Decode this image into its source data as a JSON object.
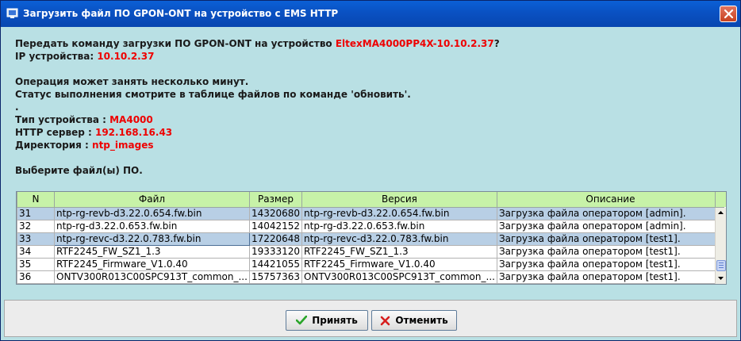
{
  "window": {
    "title": "Загрузить файл ПО GPON-ONT на устройство с EMS HTTP",
    "close_icon": "close-icon"
  },
  "info": {
    "question_prefix": "Передать команду загрузки ПО GPON-ONT на устройство ",
    "device_name": "EltexMA4000PP4X-10.10.2.37",
    "question_suffix": "?",
    "ip_label": "IP устройства: ",
    "ip_value": "10.10.2.37",
    "op_note": "Операция может занять несколько минут.",
    "status_note": "Статус выполнения смотрите в таблице файлов по команде 'обновить'.",
    "dot": ".",
    "type_label": "Тип устройства : ",
    "type_value": "MA4000",
    "http_label": "HTTP сервер : ",
    "http_value": "192.168.16.43",
    "dir_label": "Директория : ",
    "dir_value": "ntp_images",
    "choose_label": "Выберите файл(ы) ПО."
  },
  "table": {
    "headers": [
      "N",
      "Файл",
      "Размер",
      "Версия",
      "Описание"
    ],
    "rows": [
      {
        "n": "31",
        "file": "ntp-rg-revb-d3.22.0.654.fw.bin",
        "size": "14320680",
        "version": "ntp-rg-revb-d3.22.0.654.fw.bin",
        "desc": "Загрузка файла оператором [admin].",
        "selected": true
      },
      {
        "n": "32",
        "file": "ntp-rg-d3.22.0.653.fw.bin",
        "size": "14042152",
        "version": "ntp-rg-d3.22.0.653.fw.bin",
        "desc": "Загрузка файла оператором [admin].",
        "selected": false
      },
      {
        "n": "33",
        "file": "ntp-rg-revc-d3.22.0.783.fw.bin",
        "size": "17220648",
        "version": "ntp-rg-revc-d3.22.0.783.fw.bin",
        "desc": "Загрузка файла оператором [test1].",
        "selected": true
      },
      {
        "n": "34",
        "file": "RTF2245_FW_SZ1_1.3",
        "size": "19333120",
        "version": "RTF2245_FW_SZ1_1.3",
        "desc": "Загрузка файла оператором [test1].",
        "selected": false
      },
      {
        "n": "35",
        "file": "RTF2245_Firmware_V1.0.40",
        "size": "14421055",
        "version": "RTF2245_Firmware_V1.0.40",
        "desc": "Загрузка файла оператором [test1].",
        "selected": false
      },
      {
        "n": "36",
        "file": "ONTV300R013C00SPC913T_common_...",
        "size": "15757363",
        "version": "ONTV300R013C00SPC913T_common_...",
        "desc": "Загрузка файла оператором [test1].",
        "selected": false
      }
    ]
  },
  "buttons": {
    "accept_label": "Принять",
    "cancel_label": "Отменить",
    "accept_icon": "check-icon",
    "cancel_icon": "cross-icon",
    "accept_color": "#2aa52a",
    "cancel_color": "#d71e1e"
  }
}
